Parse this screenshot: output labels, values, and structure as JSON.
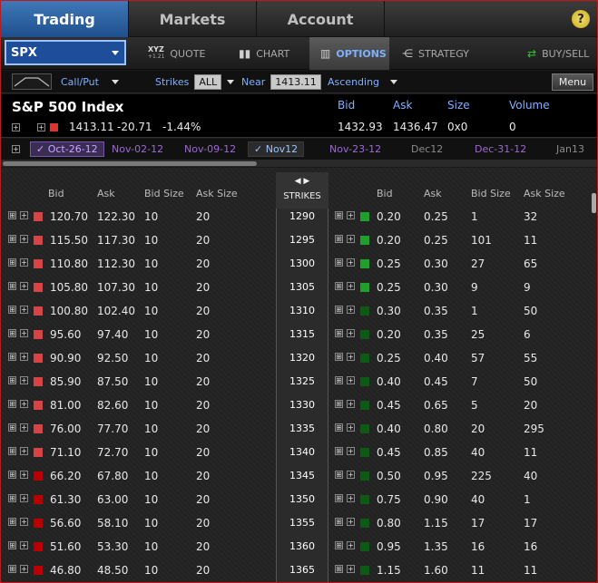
{
  "tabs": [
    "Trading",
    "Markets",
    "Account"
  ],
  "help_icon": "?",
  "symbol": "SPX",
  "subtabs": {
    "quote_glyph_top": "XYZ",
    "quote_glyph_bottom": "+1.21",
    "quote": "QUOTE",
    "chart": "CHART",
    "options": "OPTIONS",
    "strategy": "STRATEGY",
    "buysell": "BUY/SELL"
  },
  "options_bar": {
    "type": "Call/Put",
    "strikes_label": "Strikes",
    "strikes_value": "ALL",
    "near_label": "Near",
    "near_value": "1413.11",
    "sort": "Ascending",
    "menu": "Menu"
  },
  "quote": {
    "name": "S&P 500 Index",
    "last": "1413.11",
    "change": "-20.71",
    "change_pct": "-1.44%",
    "headers": {
      "bid": "Bid",
      "ask": "Ask",
      "size": "Size",
      "volume": "Volume"
    },
    "bid": "1432.93",
    "ask": "1436.47",
    "size": "0x0",
    "volume": "0"
  },
  "expirations": [
    "Oct-26-12",
    "Nov-02-12",
    "Nov-09-12",
    "Nov12",
    "Nov-23-12",
    "Dec12",
    "Dec-31-12",
    "Jan13"
  ],
  "columns": {
    "bid": "Bid",
    "ask": "Ask",
    "bid_size": "Bid Size",
    "ask_size": "Ask Size",
    "strikes": "STRIKES"
  },
  "rows": [
    {
      "strike": "1290",
      "cb": "120.70",
      "ca": "122.30",
      "cbs": "10",
      "cas": "20",
      "pb": "0.20",
      "pa": "0.25",
      "pbs": "1",
      "pas": "32"
    },
    {
      "strike": "1295",
      "cb": "115.50",
      "ca": "117.30",
      "cbs": "10",
      "cas": "20",
      "pb": "0.20",
      "pa": "0.25",
      "pbs": "101",
      "pas": "11"
    },
    {
      "strike": "1300",
      "cb": "110.80",
      "ca": "112.30",
      "cbs": "10",
      "cas": "20",
      "pb": "0.25",
      "pa": "0.30",
      "pbs": "27",
      "pas": "65"
    },
    {
      "strike": "1305",
      "cb": "105.80",
      "ca": "107.30",
      "cbs": "10",
      "cas": "20",
      "pb": "0.25",
      "pa": "0.30",
      "pbs": "9",
      "pas": "9"
    },
    {
      "strike": "1310",
      "cb": "100.80",
      "ca": "102.40",
      "cbs": "10",
      "cas": "20",
      "pb": "0.30",
      "pa": "0.35",
      "pbs": "1",
      "pas": "50"
    },
    {
      "strike": "1315",
      "cb": "95.60",
      "ca": "97.40",
      "cbs": "10",
      "cas": "20",
      "pb": "0.20",
      "pa": "0.35",
      "pbs": "25",
      "pas": "6"
    },
    {
      "strike": "1320",
      "cb": "90.90",
      "ca": "92.50",
      "cbs": "10",
      "cas": "20",
      "pb": "0.25",
      "pa": "0.40",
      "pbs": "57",
      "pas": "55"
    },
    {
      "strike": "1325",
      "cb": "85.90",
      "ca": "87.50",
      "cbs": "10",
      "cas": "20",
      "pb": "0.40",
      "pa": "0.45",
      "pbs": "7",
      "pas": "50"
    },
    {
      "strike": "1330",
      "cb": "81.00",
      "ca": "82.60",
      "cbs": "10",
      "cas": "20",
      "pb": "0.45",
      "pa": "0.65",
      "pbs": "5",
      "pas": "20"
    },
    {
      "strike": "1335",
      "cb": "76.00",
      "ca": "77.70",
      "cbs": "10",
      "cas": "20",
      "pb": "0.40",
      "pa": "0.80",
      "pbs": "20",
      "pas": "295"
    },
    {
      "strike": "1340",
      "cb": "71.10",
      "ca": "72.70",
      "cbs": "10",
      "cas": "20",
      "pb": "0.45",
      "pa": "0.85",
      "pbs": "40",
      "pas": "11"
    },
    {
      "strike": "1345",
      "cb": "66.20",
      "ca": "67.80",
      "cbs": "10",
      "cas": "20",
      "pb": "0.50",
      "pa": "0.95",
      "pbs": "225",
      "pas": "40"
    },
    {
      "strike": "1350",
      "cb": "61.30",
      "ca": "63.00",
      "cbs": "10",
      "cas": "20",
      "pb": "0.75",
      "pa": "0.90",
      "pbs": "40",
      "pas": "1"
    },
    {
      "strike": "1355",
      "cb": "56.60",
      "ca": "58.10",
      "cbs": "10",
      "cas": "20",
      "pb": "0.80",
      "pa": "1.15",
      "pbs": "17",
      "pas": "17"
    },
    {
      "strike": "1360",
      "cb": "51.60",
      "ca": "53.30",
      "cbs": "10",
      "cas": "20",
      "pb": "0.95",
      "pa": "1.35",
      "pbs": "16",
      "pas": "16"
    },
    {
      "strike": "1365",
      "cb": "46.80",
      "ca": "48.50",
      "cbs": "10",
      "cas": "20",
      "pb": "1.15",
      "pa": "1.60",
      "pbs": "11",
      "pas": "11"
    }
  ]
}
